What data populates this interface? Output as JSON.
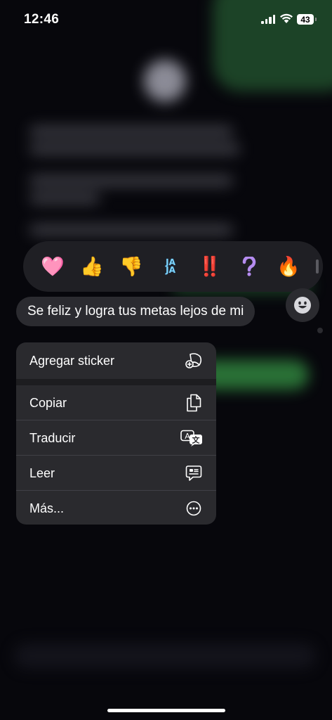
{
  "status_bar": {
    "time": "12:46",
    "battery": "43"
  },
  "reactions": [
    {
      "name": "heart",
      "glyph": "🩷"
    },
    {
      "name": "thumbs-up",
      "glyph": "👍"
    },
    {
      "name": "thumbs-down",
      "glyph": "👎"
    },
    {
      "name": "haha",
      "glyph": "JA JA"
    },
    {
      "name": "exclamation",
      "glyph": "‼️"
    },
    {
      "name": "question",
      "glyph": "❔"
    },
    {
      "name": "fire",
      "glyph": "🔥"
    }
  ],
  "message": {
    "text": "Se feliz y logra tus metas lejos de mi"
  },
  "menu": {
    "items": [
      {
        "label": "Agregar sticker",
        "icon": "sticker-add-icon"
      },
      {
        "label": "Copiar",
        "icon": "copy-icon"
      },
      {
        "label": "Traducir",
        "icon": "translate-icon"
      },
      {
        "label": "Leer",
        "icon": "read-aloud-icon"
      },
      {
        "label": "Más...",
        "icon": "more-icon"
      }
    ]
  },
  "colors": {
    "menu_bg": "#2a2a2e",
    "bubble_bg": "#2b2b30",
    "reaction_bar_bg": "#1f1f24"
  }
}
